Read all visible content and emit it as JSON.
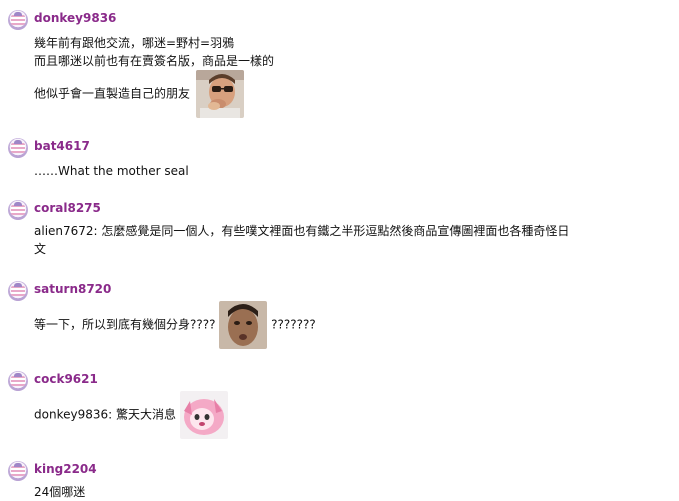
{
  "comments": [
    {
      "username": "donkey9836",
      "lines": [
        "幾年前有跟他交流，哪迷=野村=羽鴉",
        "而且哪迷以前也有在賣簽名版，商品是一樣的",
        "他似乎會一直製造自己的朋友"
      ],
      "sticker": "man-smoking-sticker"
    },
    {
      "username": "bat4617",
      "text": "……What the mother seal"
    },
    {
      "username": "coral8275",
      "lines": [
        "alien7672: 怎麼感覺是同一個人，有些噗文裡面也有鐵之半形逗點然後商品宣傳圖裡面也各種奇怪日",
        "文"
      ]
    },
    {
      "username": "saturn8720",
      "text_before": "等一下，所以到底有幾個分身????",
      "text_after": "???????",
      "sticker": "shocked-man-sticker"
    },
    {
      "username": "cock9621",
      "text": "donkey9836: 驚天大消息",
      "sticker": "pink-anime-sticker"
    },
    {
      "username": "king2204",
      "text": "24個哪迷"
    }
  ]
}
